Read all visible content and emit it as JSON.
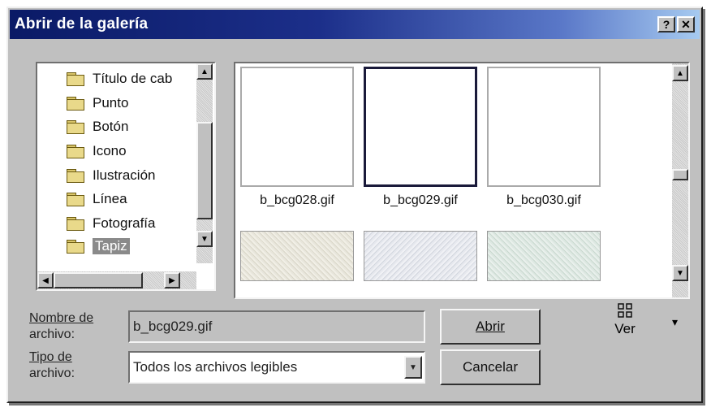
{
  "dialog": {
    "title": "Abrir de la galería",
    "help_label": "?",
    "close_label": "✕"
  },
  "folders": [
    {
      "label": "Título de cab",
      "selected": false
    },
    {
      "label": "Punto",
      "selected": false
    },
    {
      "label": "Botón",
      "selected": false
    },
    {
      "label": "Icono",
      "selected": false
    },
    {
      "label": "Ilustración",
      "selected": false
    },
    {
      "label": "Línea",
      "selected": false
    },
    {
      "label": "Fotografía",
      "selected": false
    },
    {
      "label": "Tapiz",
      "selected": true
    }
  ],
  "files": [
    {
      "name": "b_bcg028.gif",
      "selected": false
    },
    {
      "name": "b_bcg029.gif",
      "selected": true
    },
    {
      "name": "b_bcg030.gif",
      "selected": false
    }
  ],
  "form": {
    "filename_label_line1": "Nombre de",
    "filename_label_line2": "archivo:",
    "filename_value": "b_bcg029.gif",
    "filetype_label_line1": "Tipo de",
    "filetype_label_line2": "archivo:",
    "filetype_value": "Todos los archivos legibles"
  },
  "buttons": {
    "open": "Abrir",
    "cancel": "Cancelar",
    "view": "Ver"
  },
  "icons": {
    "scroll_up": "▲",
    "scroll_down": "▼",
    "scroll_left": "◀",
    "scroll_right": "▶",
    "dropdown": "▼",
    "view_menu_arrow": "▾"
  },
  "colors": {
    "titlebar_start": "#0a1a66",
    "titlebar_end": "#a6caf0",
    "face": "#c0c0c0"
  }
}
